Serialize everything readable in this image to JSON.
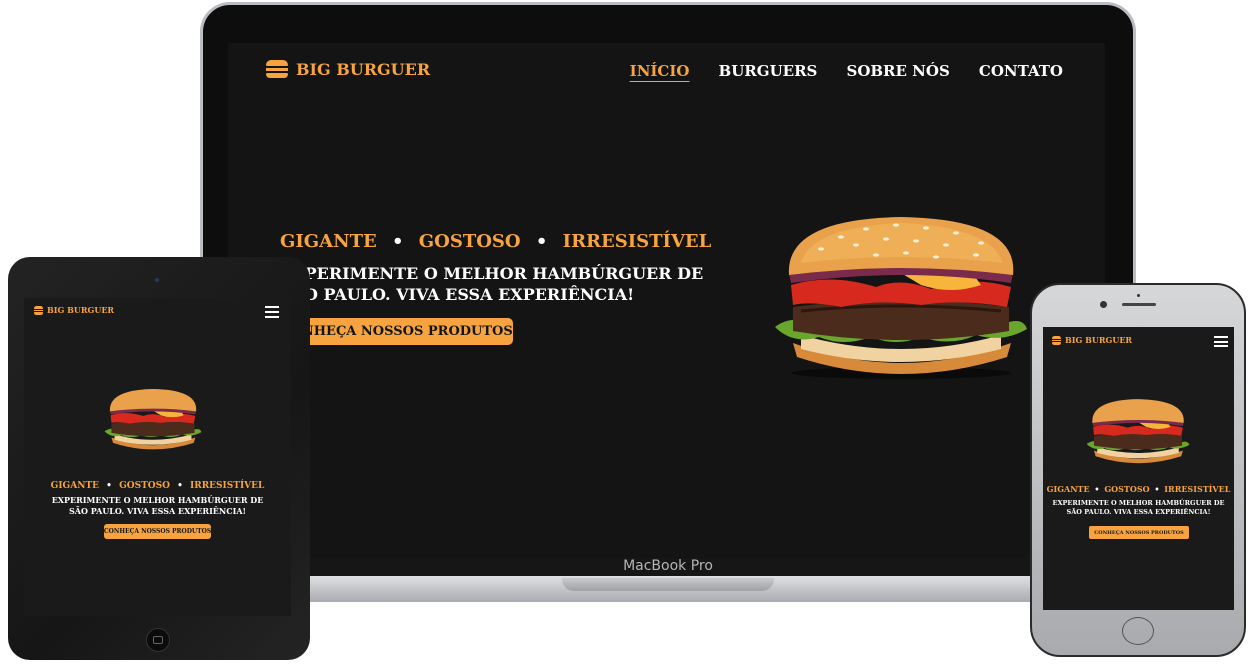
{
  "brand": {
    "name": "BIG BURGUER",
    "logo_icon": "burger-icon",
    "accent": "#f7a440"
  },
  "nav": [
    {
      "label": "INÍCIO",
      "active": true
    },
    {
      "label": "BURGUERS",
      "active": false
    },
    {
      "label": "SOBRE NÓS",
      "active": false
    },
    {
      "label": "CONTATO",
      "active": false
    }
  ],
  "hero": {
    "tagline_words": [
      "GIGANTE",
      "GOSTOSO",
      "IRRESISTÍVEL"
    ],
    "separator": "•",
    "headline_line1": "EXPERIMENTE O MELHOR HAMBÚRGUER DE",
    "headline_line2": "SÃO PAULO. VIVA ESSA EXPERIÊNCIA!",
    "cta_label": "CONHEÇA NOSSOS PRODUTOS"
  },
  "laptop": {
    "brand_label": "MacBook Pro"
  },
  "colors": {
    "background": "#141414",
    "text": "#ffffff",
    "accent": "#f7a440"
  }
}
